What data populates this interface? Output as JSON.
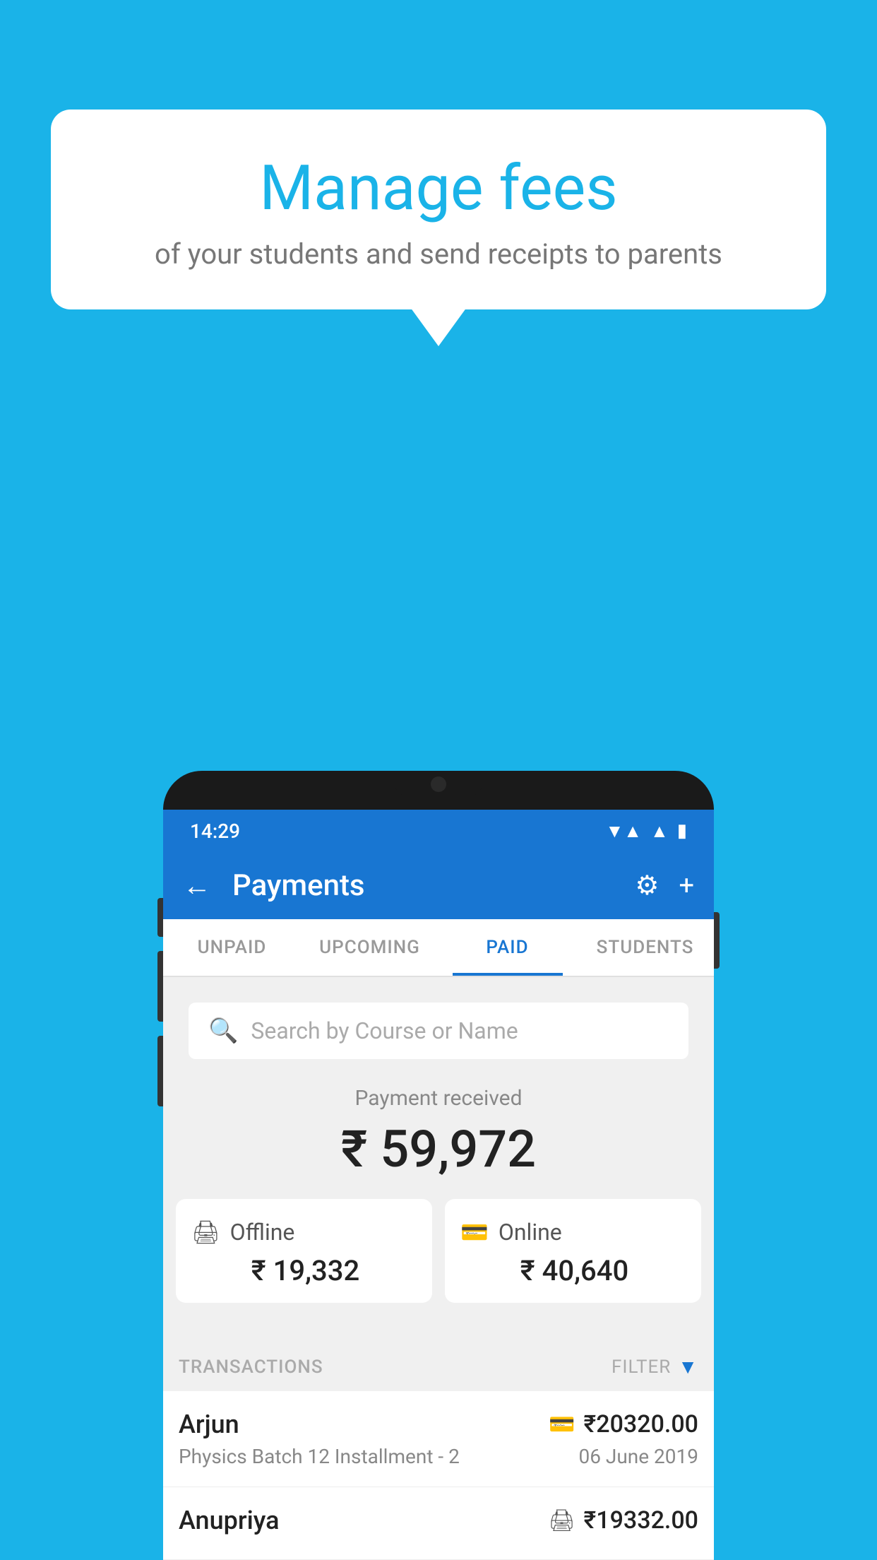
{
  "page": {
    "background_color": "#1ab3e8"
  },
  "hero": {
    "title": "Manage fees",
    "subtitle": "of your students and send receipts to parents"
  },
  "phone": {
    "status_bar": {
      "time": "14:29",
      "signal_icon": "▲",
      "wifi_icon": "▼"
    },
    "toolbar": {
      "title": "Payments",
      "back_label": "←",
      "settings_icon": "⚙",
      "add_icon": "+"
    },
    "tabs": [
      {
        "label": "UNPAID",
        "active": false
      },
      {
        "label": "UPCOMING",
        "active": false
      },
      {
        "label": "PAID",
        "active": true
      },
      {
        "label": "STUDENTS",
        "active": false
      }
    ],
    "search": {
      "placeholder": "Search by Course or Name"
    },
    "payment_summary": {
      "label": "Payment received",
      "amount": "₹ 59,972",
      "offline": {
        "label": "Offline",
        "amount": "₹ 19,332"
      },
      "online": {
        "label": "Online",
        "amount": "₹ 40,640"
      }
    },
    "transactions": {
      "header_label": "TRANSACTIONS",
      "filter_label": "FILTER",
      "items": [
        {
          "name": "Arjun",
          "course": "Physics Batch 12 Installment - 2",
          "amount": "₹20320.00",
          "date": "06 June 2019",
          "payment_type": "online"
        },
        {
          "name": "Anupriya",
          "course": "",
          "amount": "₹19332.00",
          "date": "",
          "payment_type": "offline"
        }
      ]
    }
  }
}
